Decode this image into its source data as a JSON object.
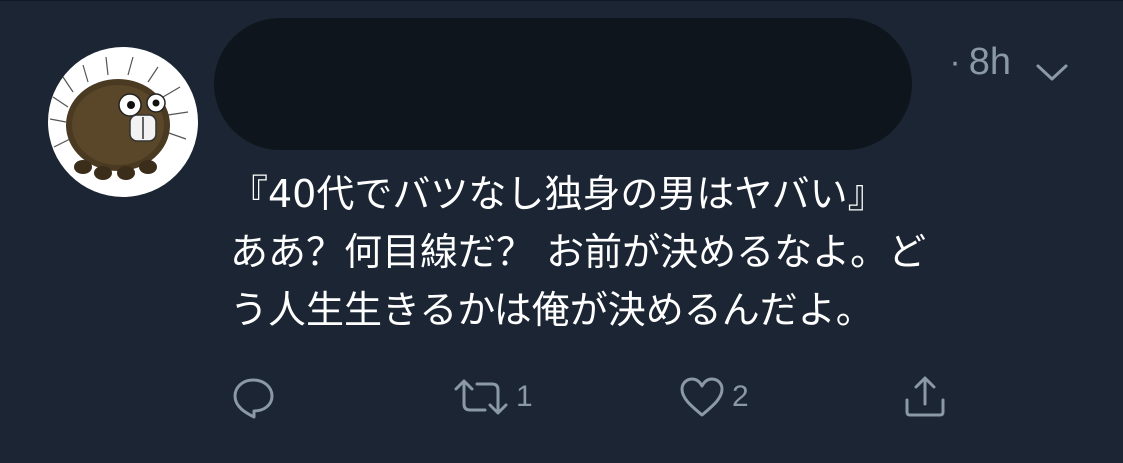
{
  "tweet": {
    "timestamp": "8h",
    "text_lines": [
      "『40代でバツなし独身の男はヤバい』",
      "ああ？何目線だ？ お前が決めるなよ。ど",
      "う人生生きるかは俺が決めるんだよ。"
    ],
    "avatar": "hedgehog-creature-avatar",
    "actions": {
      "reply_icon": "reply-icon",
      "retweet_icon": "retweet-icon",
      "retweet_count": "1",
      "like_icon": "heart-icon",
      "like_count": "2",
      "share_icon": "share-icon"
    }
  },
  "colors": {
    "background": "#1b2533",
    "text": "#ffffff",
    "muted": "#8b98a5",
    "redaction": "#0f151d"
  }
}
